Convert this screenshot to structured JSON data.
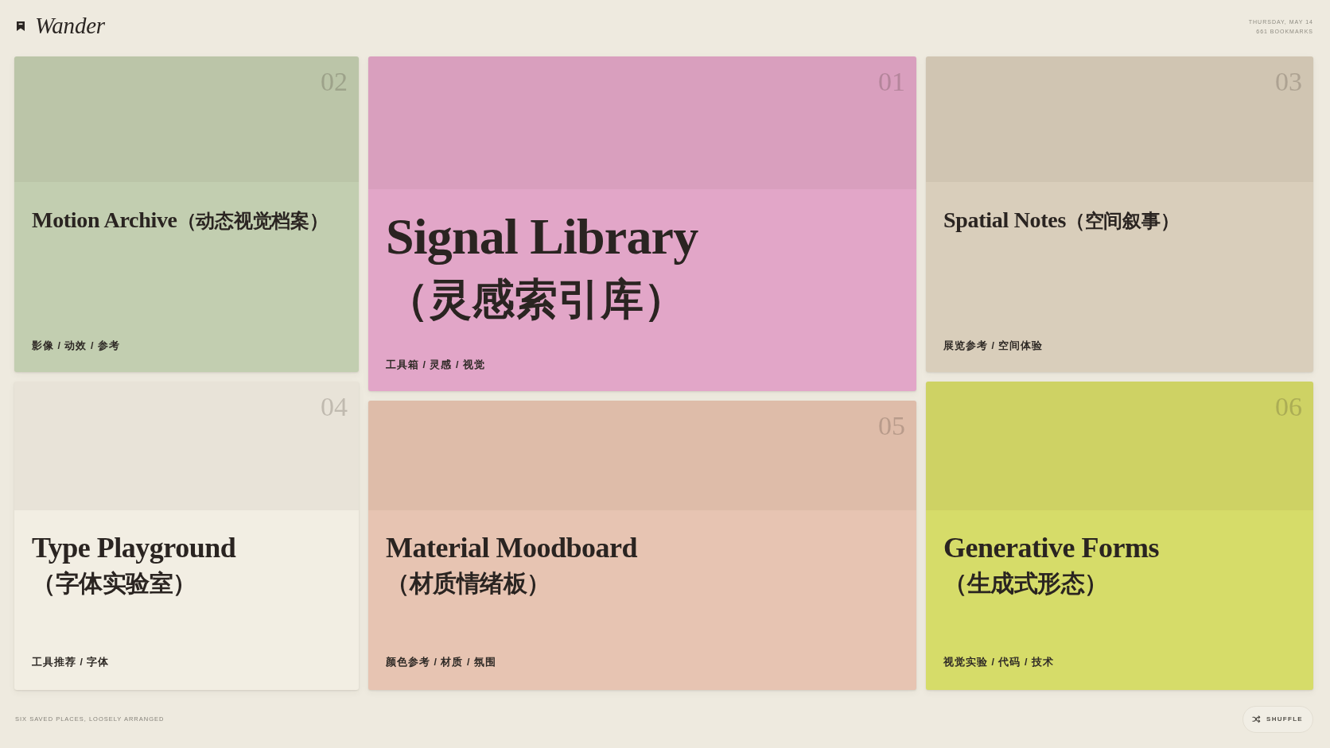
{
  "header": {
    "brand": "Wander",
    "date": "THURSDAY, MAY 14",
    "count": "661 BOOKMARKS"
  },
  "columns": [
    {
      "cards": [
        {
          "kind": "compact",
          "number": "02",
          "title": "Motion Archive",
          "subtitle": "（动态视觉档案）",
          "tags": "影像 / 动效 / 参考",
          "color": "#c2ceb0"
        },
        {
          "kind": "stacked",
          "number": "04",
          "title": "Type Playground",
          "subtitle": "（字体实验室）",
          "tags": "工具推荐 / 字体",
          "color": "#f2eee3"
        }
      ]
    },
    {
      "cards": [
        {
          "kind": "feature",
          "number": "01",
          "title": "Signal Library",
          "subtitle": "（灵感索引库）",
          "tags": "工具箱 / 灵感 / 视觉",
          "color": "#e2a6c8"
        },
        {
          "kind": "stacked",
          "number": "05",
          "title": "Material Moodboard",
          "subtitle": "（材质情绪板）",
          "tags": "颜色参考 / 材质 / 氛围",
          "color": "#e7c4b2"
        }
      ]
    },
    {
      "cards": [
        {
          "kind": "compact",
          "number": "03",
          "title": "Spatial Notes",
          "subtitle": "（空间叙事）",
          "tags": "展览参考 / 空间体验",
          "color": "#d9cebb"
        },
        {
          "kind": "stacked",
          "number": "06",
          "title": "Generative Forms",
          "subtitle": "（生成式形态）",
          "tags": "视觉实验 / 代码 / 技术",
          "color": "#d6dc69"
        }
      ]
    }
  ],
  "footer": {
    "caption": "SIX SAVED PLACES, LOOSELY ARRANGED",
    "shuffle": "SHUFFLE"
  }
}
